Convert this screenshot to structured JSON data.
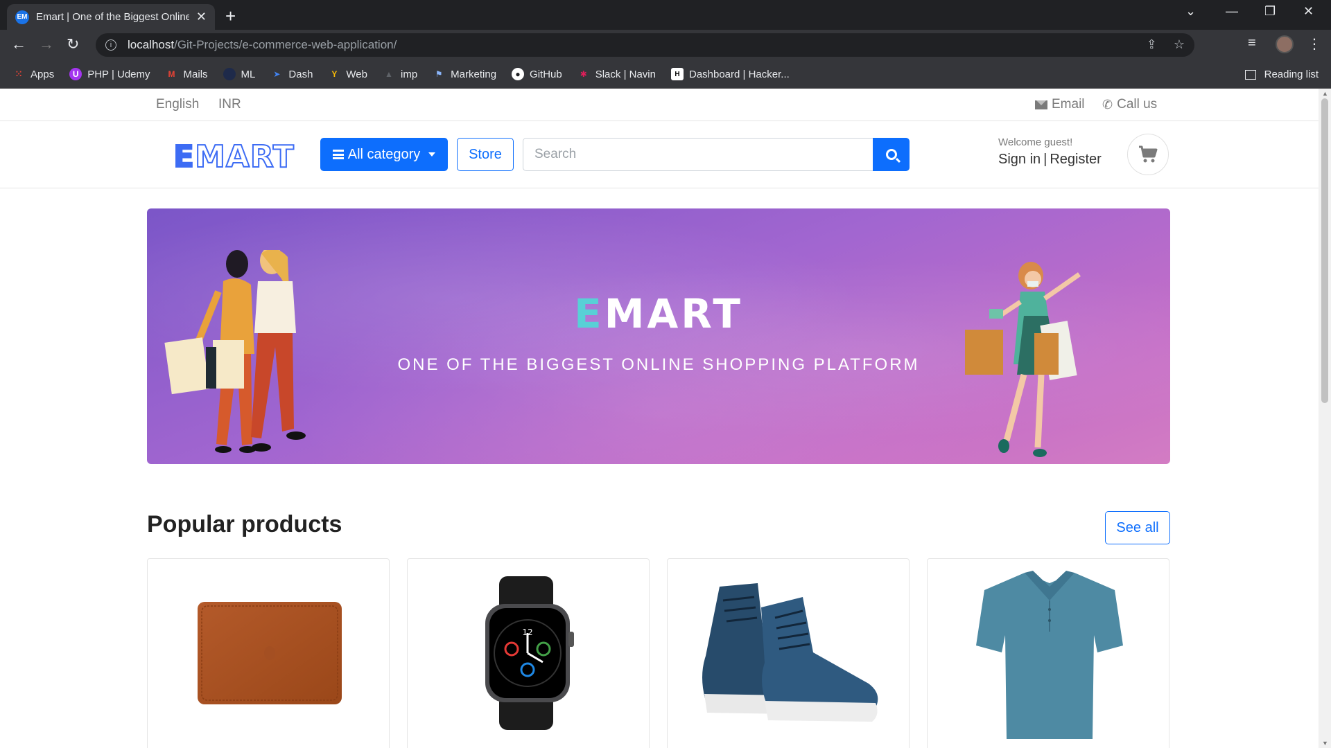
{
  "browser": {
    "tab_title": "Emart | One of the Biggest Online Shopping Platform",
    "favicon_text": "EM",
    "url_host": "localhost",
    "url_path": "/Git-Projects/e-commerce-web-application/",
    "bookmarks": [
      {
        "label": "Apps",
        "icon": "apps-grid-icon",
        "color": "#ea4335"
      },
      {
        "label": "PHP | Udemy",
        "icon": "udemy-icon",
        "color": "#a435f0"
      },
      {
        "label": "Mails",
        "icon": "gmail-icon",
        "color": "#ea4335"
      },
      {
        "label": "ML",
        "icon": "ml-icon",
        "color": "#1e2a4a"
      },
      {
        "label": "Dash",
        "icon": "dash-icon",
        "color": "#4285f4"
      },
      {
        "label": "Web",
        "icon": "web-icon",
        "color": "#fbbc05"
      },
      {
        "label": "imp",
        "icon": "imp-icon",
        "color": "#3c4043"
      },
      {
        "label": "Marketing",
        "icon": "marketing-icon",
        "color": "#5f6368"
      },
      {
        "label": "GitHub",
        "icon": "github-icon",
        "color": "#ffffff"
      },
      {
        "label": "Slack | Navin",
        "icon": "slack-icon",
        "color": "#e01e5a"
      },
      {
        "label": "Dashboard | Hacker...",
        "icon": "hackerrank-icon",
        "color": "#00ea64"
      }
    ],
    "reading_list": "Reading list"
  },
  "topbar": {
    "language": "English",
    "currency": "INR",
    "email": "Email",
    "call": "Call us"
  },
  "header": {
    "logo": "EMART",
    "category_button": "All category",
    "store_button": "Store",
    "search_placeholder": "Search",
    "welcome": "Welcome guest!",
    "sign_in": "Sign in",
    "separator": "|",
    "register": "Register",
    "accent_color": "#0d6efd"
  },
  "banner": {
    "title_first": "E",
    "title_rest": "MART",
    "subtitle": "ONE OF THE BIGGEST ONLINE SHOPPING PLATFORM"
  },
  "popular": {
    "title": "Popular products",
    "see_all": "See all",
    "products": [
      {
        "icon": "laptop-sleeve-icon"
      },
      {
        "icon": "smartwatch-icon"
      },
      {
        "icon": "sneaker-icon"
      },
      {
        "icon": "polo-shirt-icon"
      }
    ]
  }
}
